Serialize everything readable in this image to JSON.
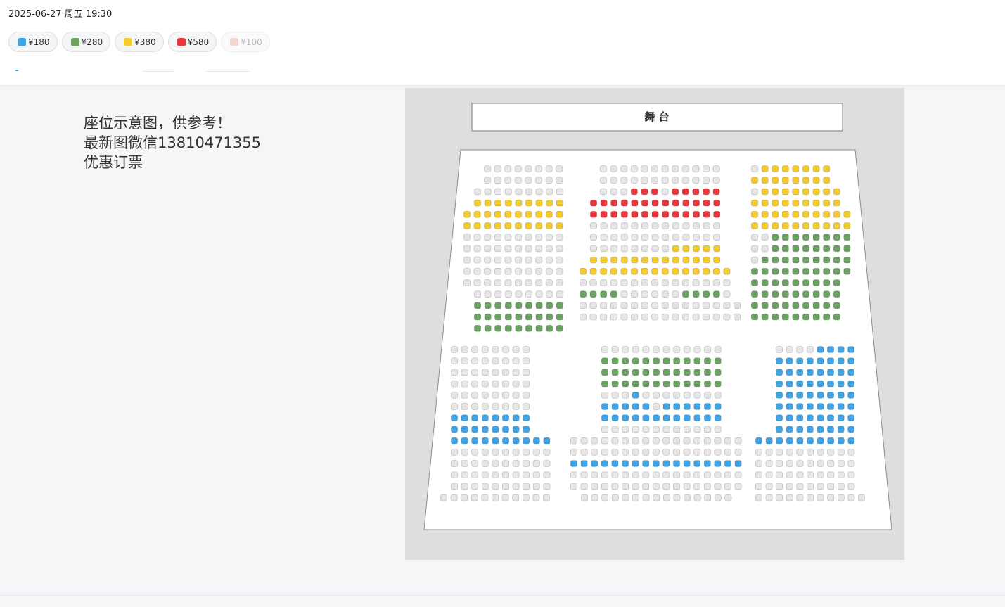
{
  "show": {
    "datetime": "2025-06-27 周五 19:30"
  },
  "prices": [
    {
      "label": "¥180",
      "color": "#3fa3e6",
      "enabled": true
    },
    {
      "label": "¥280",
      "color": "#6aa261",
      "enabled": true
    },
    {
      "label": "¥380",
      "color": "#f3cb2e",
      "enabled": true
    },
    {
      "label": "¥580",
      "color": "#e8383c",
      "enabled": true
    },
    {
      "label": "¥100",
      "color": "#f3d6d0",
      "enabled": false
    }
  ],
  "note": {
    "line1": "座位示意图，供参考！",
    "line2": "最新图微信13810471355",
    "line3": "优惠订票"
  },
  "seatmap": {
    "stage_label": "舞 台",
    "colors": {
      "180": "#3fa3e6",
      "280": "#6aa261",
      "380": "#f3cb2e",
      "580": "#e8383c",
      "sold": "#e6e6e6"
    }
  }
}
